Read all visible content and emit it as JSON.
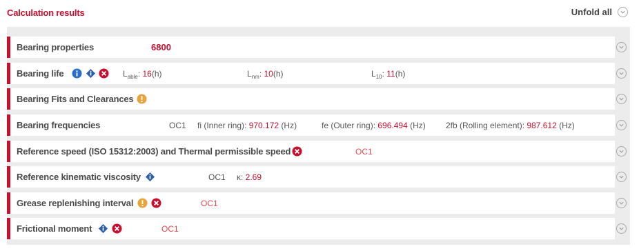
{
  "header": {
    "title": "Calculation results",
    "unfold_label": "Unfold all"
  },
  "rows": [
    {
      "label": "Bearing properties",
      "designation": "6800"
    },
    {
      "label": "Bearing life",
      "values": [
        {
          "symbol": "L",
          "sub": "able",
          "sep": ": ",
          "value": "16",
          "unit": "(h)"
        },
        {
          "symbol": "L",
          "sub": "nm",
          "sep": ": ",
          "value": "10",
          "unit": "(h)"
        },
        {
          "symbol": "L",
          "sub": "10",
          "sep": ": ",
          "value": "11",
          "unit": "(h)"
        }
      ]
    },
    {
      "label": "Bearing Fits and Clearances"
    },
    {
      "label": "Bearing frequencies",
      "clearance": "OC1",
      "values": [
        {
          "label": "fi (Inner ring): ",
          "value": "970.172",
          "unit": " (Hz)"
        },
        {
          "label": "fe (Outer ring): ",
          "value": "696.494",
          "unit": " (Hz)"
        },
        {
          "label": "2fb (Rolling element): ",
          "value": "987.612",
          "unit": " (Hz)"
        }
      ]
    },
    {
      "label": "Reference speed (ISO 15312:2003) and Thermal permissible speed",
      "clearance": "OC1"
    },
    {
      "label": "Reference kinematic viscosity",
      "clearance": "OC1",
      "value_label": "κ: ",
      "value": "2.69"
    },
    {
      "label": "Grease replenishing interval",
      "clearance": "OC1"
    },
    {
      "label": "Frictional moment",
      "clearance": "OC1"
    }
  ],
  "colors": {
    "accent": "#c8102e",
    "info_blue": "#2a6fc9",
    "diamond_blue": "#2c5fa8",
    "warning_orange": "#e8a33a",
    "error_red": "#c8102e",
    "panel_bg": "#ececec"
  },
  "icons": {
    "info": "info-icon",
    "diamond": "diamond-info-icon",
    "warning": "warning-icon",
    "error": "error-icon",
    "chevron": "chevron-down-icon"
  }
}
